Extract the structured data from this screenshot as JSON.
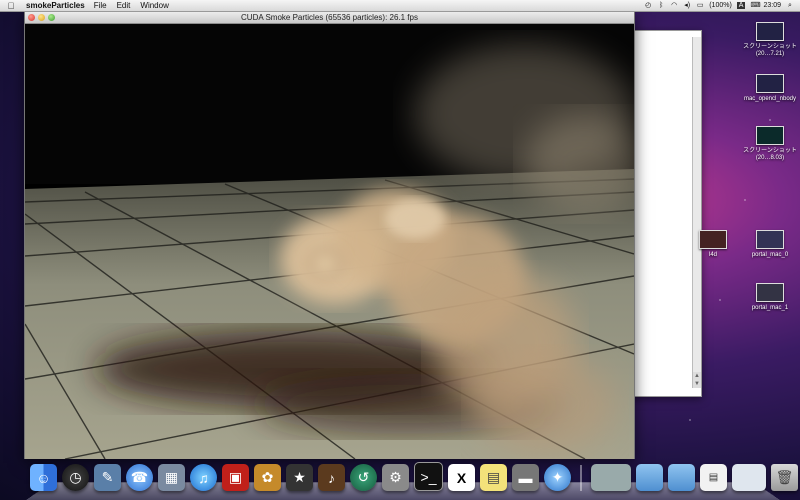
{
  "menubar": {
    "app_name": "smokeParticles",
    "menus": [
      "File",
      "Edit",
      "Window"
    ],
    "battery": "(100%)",
    "input_indicator": "A",
    "clock": "23:09"
  },
  "window": {
    "title": "CUDA Smoke Particles (65536 particles): 26.1 fps"
  },
  "desktop_icons": [
    {
      "label": "スクリーンショット (20…7.21)",
      "icon": "screenshot-icon"
    },
    {
      "label": "mac_opencl_nbody",
      "icon": "app-icon"
    },
    {
      "label": "スクリーンショット (20…8.03)",
      "icon": "screenshot-icon"
    },
    {
      "label": "l4d",
      "icon": "app-icon"
    },
    {
      "label": "portal_mac_0",
      "icon": "screenshot-icon"
    },
    {
      "label": "portal_mac_1",
      "icon": "screenshot-icon"
    }
  ],
  "dock": {
    "items": [
      "finder",
      "dashboard",
      "preview",
      "ichat",
      "iphoto-slides",
      "itunes",
      "photo-booth",
      "iphoto",
      "imovie",
      "garageband",
      "time-machine",
      "system-preferences",
      "terminal",
      "x11",
      "stickies",
      "drive",
      "safari",
      "window",
      "folder",
      "folder",
      "document",
      "finder-window",
      "trash"
    ]
  },
  "colors": {
    "accent": "#3875d7",
    "close": "#d8342b",
    "minimize": "#d9a21c",
    "zoom": "#3d9e2f"
  }
}
